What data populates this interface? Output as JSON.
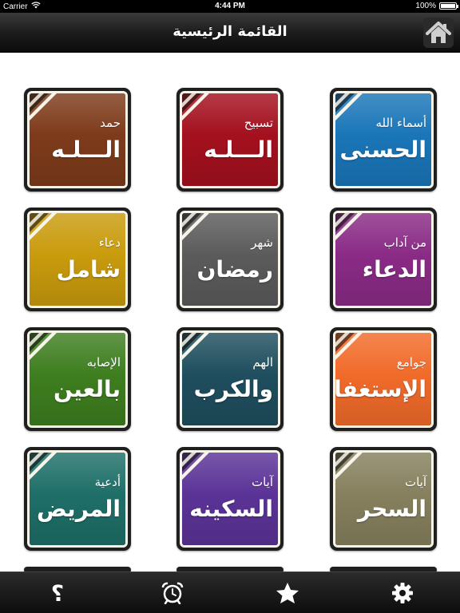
{
  "status_bar": {
    "carrier": "Carrier",
    "time": "4:44 PM",
    "battery": "100%",
    "battery_level": 1.0
  },
  "nav_bar": {
    "title": "القائمة الرئيسية",
    "home_icon": "home-icon"
  },
  "colors": {
    "brown": "#7e3b1b",
    "red": "#a4101e",
    "blue": "#1a76b8",
    "yellow": "#c99b0d",
    "gray": "#5b5b5b",
    "purple": "#8a2b86",
    "green": "#3e7e1f",
    "teal": "#1f4e5e",
    "orange": "#f16b2a",
    "dark_teal": "#1e6f68",
    "violet": "#5b3397",
    "olive": "#86805e"
  },
  "tiles": [
    {
      "small": "حمد",
      "big": "الـــلـه",
      "color": "#7e3b1b"
    },
    {
      "small": "تسبيح",
      "big": "الـــلـه",
      "color": "#a4101e"
    },
    {
      "small": "أسماء الله",
      "big": "الحسنى",
      "color": "#1a76b8"
    },
    {
      "small": "دعاء",
      "big": "شامل",
      "color": "#c99b0d"
    },
    {
      "small": "شهر",
      "big": "رمضان",
      "color": "#5b5b5b"
    },
    {
      "small": "من آداب",
      "big": "الدعاء",
      "color": "#8a2b86"
    },
    {
      "small": "الإصابه",
      "big": "بالعين",
      "color": "#3e7e1f"
    },
    {
      "small": "الهم",
      "big": "والكرب",
      "color": "#1f4e5e"
    },
    {
      "small": "جوامع",
      "big": "الإستغفارات",
      "color": "#f16b2a"
    },
    {
      "small": "أدعية",
      "big": "المريض",
      "color": "#1e6f68"
    },
    {
      "small": "آيات",
      "big": "السكينه",
      "color": "#5b3397"
    },
    {
      "small": "آيات",
      "big": "السحر",
      "color": "#86805e"
    }
  ],
  "tab_bar": {
    "tabs": [
      {
        "icon": "question-mark-icon",
        "symbol": "؟"
      },
      {
        "icon": "alarm-clock-icon"
      },
      {
        "icon": "star-icon"
      },
      {
        "icon": "gear-icon"
      }
    ]
  }
}
